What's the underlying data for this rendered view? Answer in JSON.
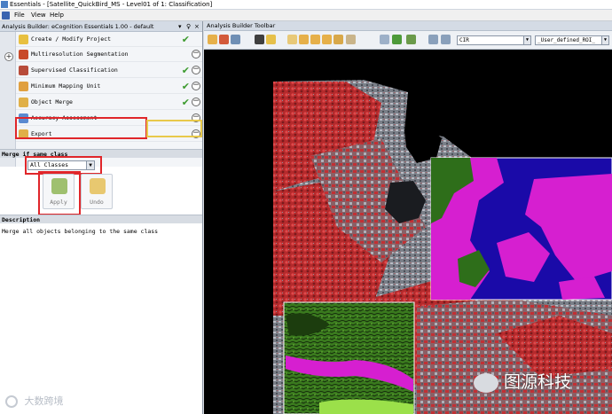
{
  "window": {
    "title": "Essentials - [Satellite_QuickBird_MS - Level01 of 1: Classification]"
  },
  "menu": [
    "File",
    "View",
    "Help"
  ],
  "left_panel": {
    "title": "Analysis Builder: eCognition Essentials 1.00 - default",
    "controls": [
      "▾",
      "♀",
      "×"
    ],
    "steps": [
      {
        "label": "Create / Modify Project",
        "icon_color": "#e8c040",
        "checked": true,
        "has_remove": false
      },
      {
        "label": "Multiresolution Segmentation",
        "icon_color": "#c84a2a",
        "checked": false,
        "has_remove": true
      },
      {
        "label": "Supervised Classification",
        "icon_color": "#b84c3a",
        "checked": true,
        "has_remove": true
      },
      {
        "label": "Minimum Mapping Unit",
        "icon_color": "#e0a040",
        "checked": true,
        "has_remove": true
      },
      {
        "label": "Object Merge",
        "icon_color": "#e0b048",
        "checked": true,
        "has_remove": true
      },
      {
        "label": "Accuracy Assessment",
        "icon_color": "#5a8ad0",
        "checked": false,
        "has_remove": true
      },
      {
        "label": "Export",
        "icon_color": "#e0b048",
        "checked": false,
        "has_remove": true
      }
    ],
    "section_title": "Merge if same class",
    "class_select": "All Classes",
    "apply_label": "Apply",
    "undo_label": "Undo",
    "description_title": "Description",
    "description_text": "Merge all objects belonging to the same class"
  },
  "right_panel": {
    "title": "Analysis Builder Toolbar",
    "visualization_select": "CIR",
    "roi_select": "_User_defined_ROI_"
  },
  "watermarks": {
    "left": "大数跨境",
    "right": "图源科技"
  }
}
